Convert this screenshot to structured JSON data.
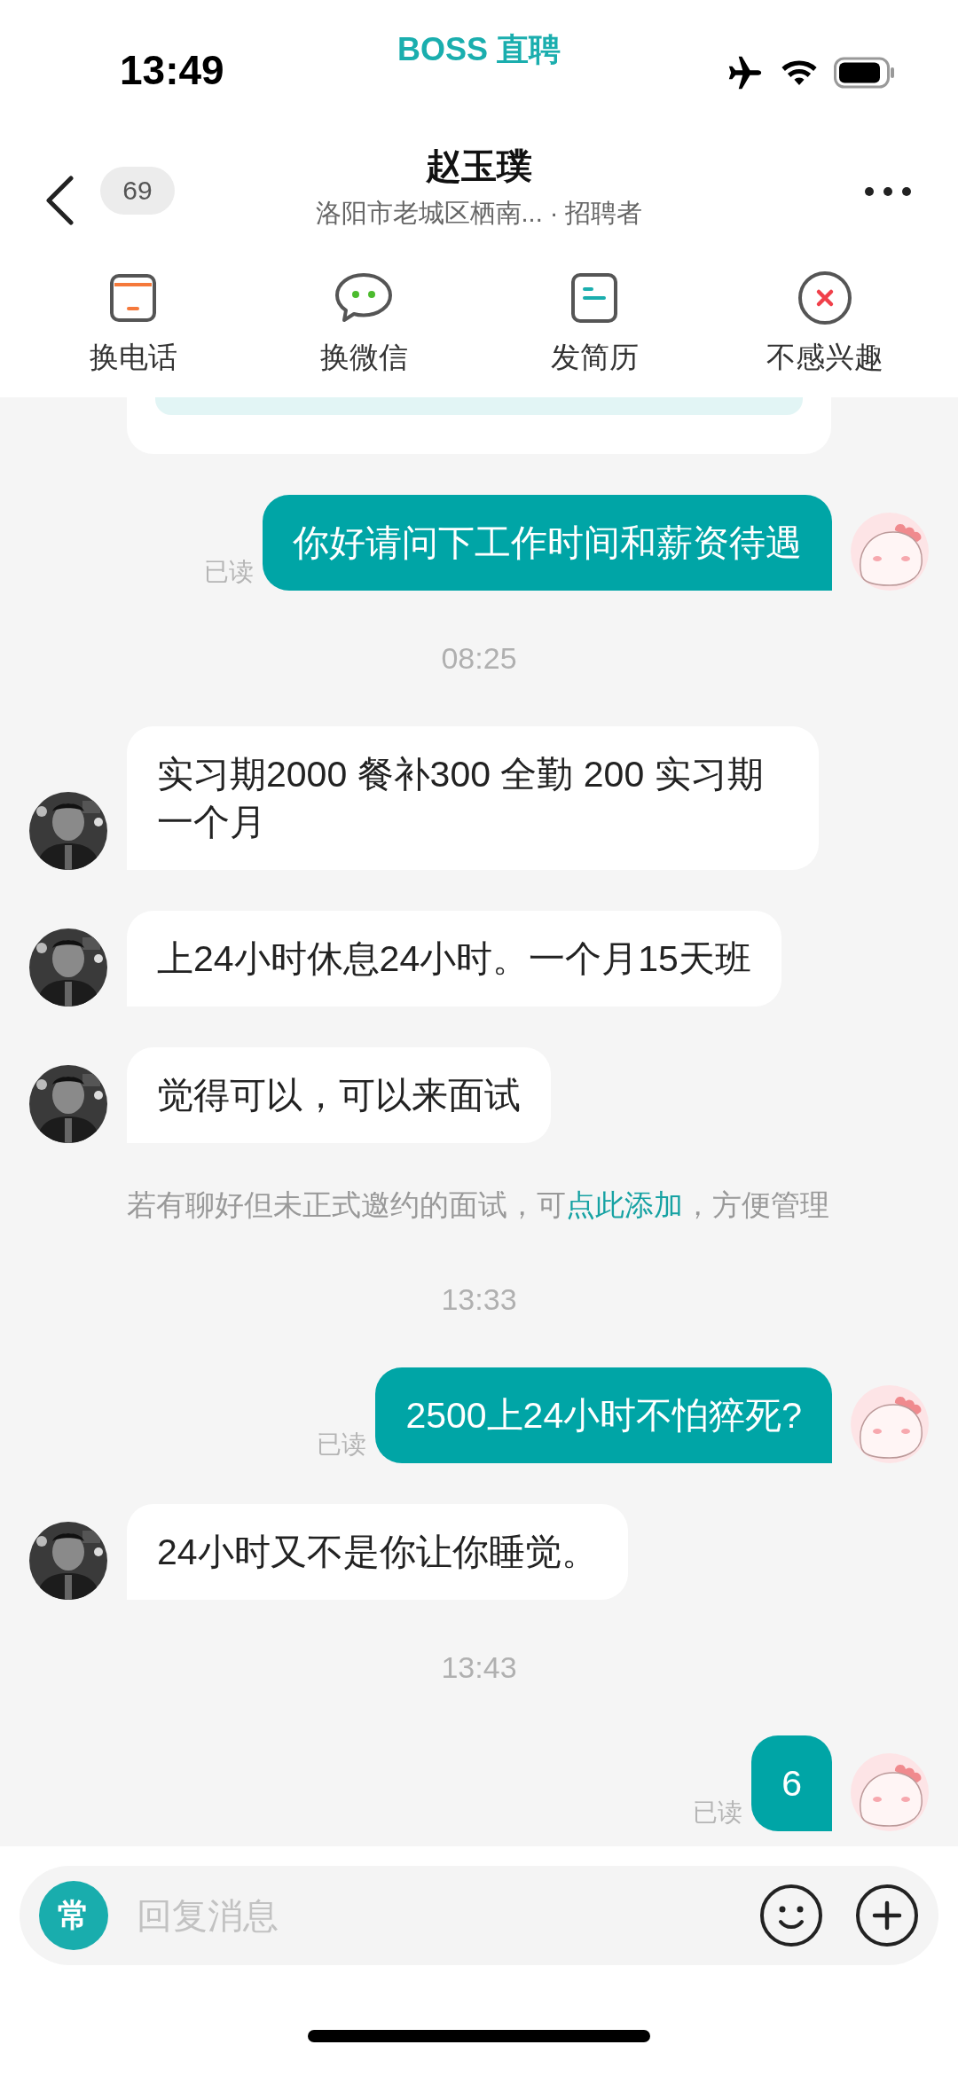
{
  "status_bar": {
    "time": "13:49",
    "app_logo": "BOSS 直聘"
  },
  "header": {
    "badge": "69",
    "title": "赵玉璞",
    "subtitle": "洛阳市老城区栖南... · 招聘者"
  },
  "actions": [
    {
      "kind": "phone",
      "label": "换电话"
    },
    {
      "kind": "wechat",
      "label": "换微信"
    },
    {
      "kind": "resume",
      "label": "发简历"
    },
    {
      "kind": "dislike",
      "label": "不感兴趣"
    }
  ],
  "chat": [
    {
      "kind": "card"
    },
    {
      "kind": "sent",
      "text": "你好请问下工作时间和薪资待遇",
      "status": "已读"
    },
    {
      "kind": "time",
      "text": "08:25"
    },
    {
      "kind": "received",
      "text": "实习期2000 餐补300 全勤 200 实习期一个月"
    },
    {
      "kind": "received",
      "text": "上24小时休息24小时。一个月15天班"
    },
    {
      "kind": "received",
      "text": "觉得可以，可以来面试"
    },
    {
      "kind": "hint",
      "before": "若有聊好但未正式邀约的面试，可",
      "link": "点此添加",
      "after": "，方便管理"
    },
    {
      "kind": "time",
      "text": "13:33"
    },
    {
      "kind": "sent",
      "text": "2500上24小时不怕猝死?",
      "status": "已读"
    },
    {
      "kind": "received",
      "text": "24小时又不是你让你睡觉。"
    },
    {
      "kind": "time",
      "text": "13:43"
    },
    {
      "kind": "sent",
      "text": "6",
      "status": "已读"
    }
  ],
  "input": {
    "shortcut": "常",
    "placeholder": "回复消息"
  }
}
